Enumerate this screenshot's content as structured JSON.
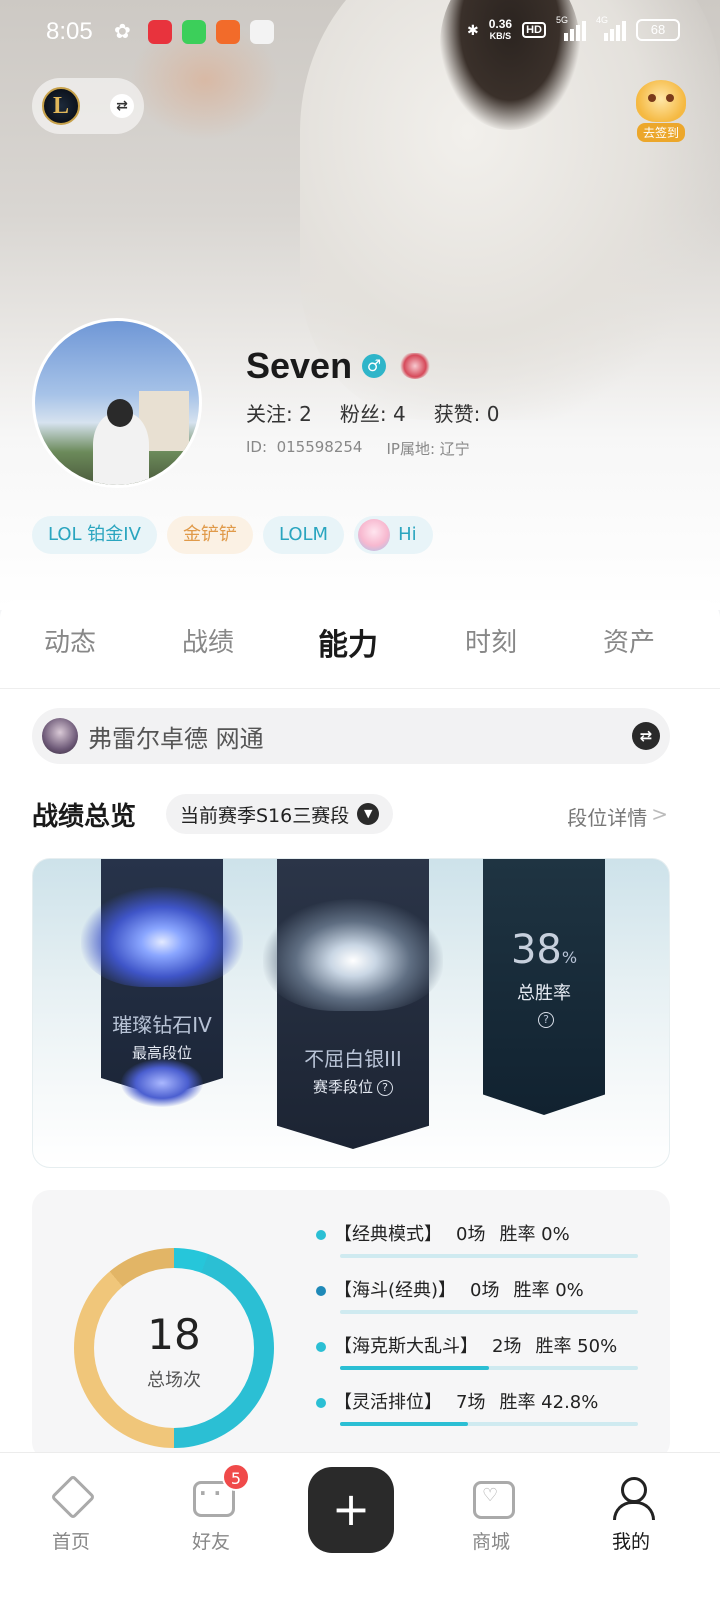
{
  "status_bar": {
    "time": "8:05",
    "net_speed": "0.36",
    "net_unit": "KB/S",
    "hd": "HD",
    "sig1": "5G",
    "sig2": "4G",
    "battery": "68"
  },
  "header": {
    "check_in_label": "去签到"
  },
  "profile": {
    "username": "Seven",
    "gender_icon": "male-icon",
    "follow_label": "关注:",
    "follow_count": "2",
    "fans_label": "粉丝:",
    "fans_count": "4",
    "likes_label": "获赞:",
    "likes_count": "0",
    "id_label": "ID:",
    "id_value": "015598254",
    "ip_label": "IP属地:",
    "ip_value": "辽宁"
  },
  "tags": [
    {
      "label": "LOL 铂金IV",
      "color": "#2aa5bf"
    },
    {
      "label": "金铲铲",
      "color": "#e09a4a"
    },
    {
      "label": "LOLM",
      "color": "#2aa5bf"
    },
    {
      "label": "Hi",
      "color": "#2aa5bf"
    }
  ],
  "tabs": [
    "动态",
    "战绩",
    "能力",
    "时刻",
    "资产"
  ],
  "active_tab": "能力",
  "hero_bar": {
    "name": "弗雷尔卓德 网通"
  },
  "overview": {
    "title": "战绩总览",
    "season": "当前赛季S16三赛段",
    "detail_link": "段位详情",
    "chevron": ">"
  },
  "ranks": {
    "highest_rank": "璀璨钻石IV",
    "highest_label": "最高段位",
    "season_rank": "不屈白银III",
    "season_label": "赛季段位",
    "win_rate": "38",
    "win_rate_unit": "%",
    "win_rate_label": "总胜率",
    "help": "?"
  },
  "games": {
    "total": "18",
    "total_label": "总场次",
    "modes": [
      {
        "name": "【经典模式】",
        "games": "0场",
        "win": "胜率 0%",
        "win_fraction": 0
      },
      {
        "name": "【海斗(经典)】",
        "games": "0场",
        "win": "胜率 0%",
        "win_fraction": 0
      },
      {
        "name": "【海克斯大乱斗】",
        "games": "2场",
        "win": "胜率 50%",
        "win_fraction": 0.5
      },
      {
        "name": "【灵活排位】",
        "games": "7场",
        "win": "胜率 42.8%",
        "win_fraction": 0.428
      }
    ]
  },
  "nav": {
    "home": "首页",
    "friends": "好友",
    "friends_badge": "5",
    "plus": "+",
    "shop": "商城",
    "me": "我的"
  },
  "colors": {
    "accent": "#2bbfd4",
    "gold": "#f0c67a",
    "badge": "#f04a4a"
  }
}
